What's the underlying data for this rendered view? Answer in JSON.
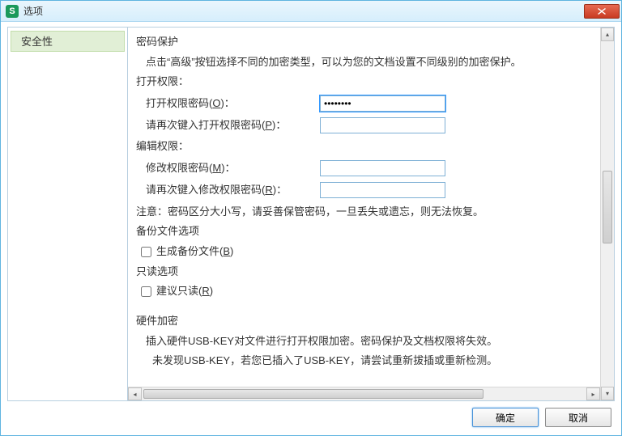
{
  "window": {
    "title": "选项"
  },
  "sidebar": {
    "items": [
      {
        "label": "安全性",
        "selected": true
      }
    ]
  },
  "content": {
    "pwd_protect_header": "密码保护",
    "pwd_protect_desc": "点击“高级”按钮选择不同的加密类型，可以为您的文档设置不同级别的加密保护。",
    "open_perm_header": "打开权限：",
    "open_pwd_label_pre": "打开权限密码(",
    "open_pwd_key": "O",
    "open_pwd_label_post": ")：",
    "open_pwd_value": "********",
    "open_pwd_confirm_pre": "请再次键入打开权限密码(",
    "open_pwd_confirm_key": "P",
    "open_pwd_confirm_post": ")：",
    "open_pwd_confirm_value": "",
    "edit_perm_header": "编辑权限：",
    "mod_pwd_label_pre": "修改权限密码(",
    "mod_pwd_key": "M",
    "mod_pwd_label_post": ")：",
    "mod_pwd_value": "",
    "mod_pwd_confirm_pre": "请再次键入修改权限密码(",
    "mod_pwd_confirm_key": "R",
    "mod_pwd_confirm_post": ")：",
    "mod_pwd_confirm_value": "",
    "note": "注意：密码区分大小写，请妥善保管密码，一旦丢失或遗忘，则无法恢复。",
    "backup_header": "备份文件选项",
    "backup_chk_pre": "生成备份文件(",
    "backup_chk_key": "B",
    "backup_chk_post": ")",
    "readonly_header": "只读选项",
    "readonly_chk_pre": "建议只读(",
    "readonly_chk_key": "R",
    "readonly_chk_post": ")",
    "hw_header": "硬件加密",
    "hw_line1": "插入硬件USB-KEY对文件进行打开权限加密。密码保护及文档权限将失效。",
    "hw_line2": "未发现USB-KEY，若您已插入了USB-KEY，请尝试重新拔插或重新检测。"
  },
  "buttons": {
    "ok": "确定",
    "cancel": "取消"
  }
}
